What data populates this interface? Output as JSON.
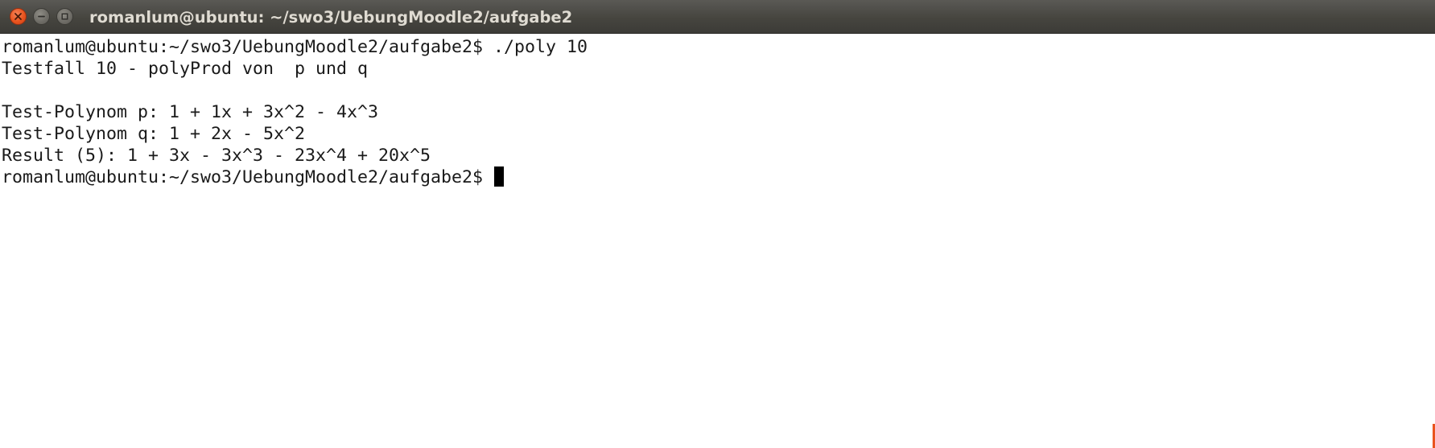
{
  "window": {
    "title": "romanlum@ubuntu: ~/swo3/UebungMoodle2/aufgabe2",
    "controls": {
      "close_icon": "close-icon",
      "minimize_icon": "minimize-icon",
      "maximize_icon": "maximize-icon"
    },
    "colors": {
      "titlebar": "#3c3b37",
      "close_button": "#e9541e",
      "title_text": "#dfdbd2",
      "terminal_bg": "#ffffff",
      "terminal_fg": "#1a1a1a"
    }
  },
  "terminal": {
    "lines": [
      "romanlum@ubuntu:~/swo3/UebungMoodle2/aufgabe2$ ./poly 10",
      "Testfall 10 - polyProd von  p und q",
      "",
      "Test-Polynom p: 1 + 1x + 3x^2 - 4x^3",
      "Test-Polynom q: 1 + 2x - 5x^2",
      "Result (5): 1 + 3x - 3x^3 - 23x^4 + 20x^5"
    ],
    "prompt": "romanlum@ubuntu:~/swo3/UebungMoodle2/aufgabe2$ "
  }
}
